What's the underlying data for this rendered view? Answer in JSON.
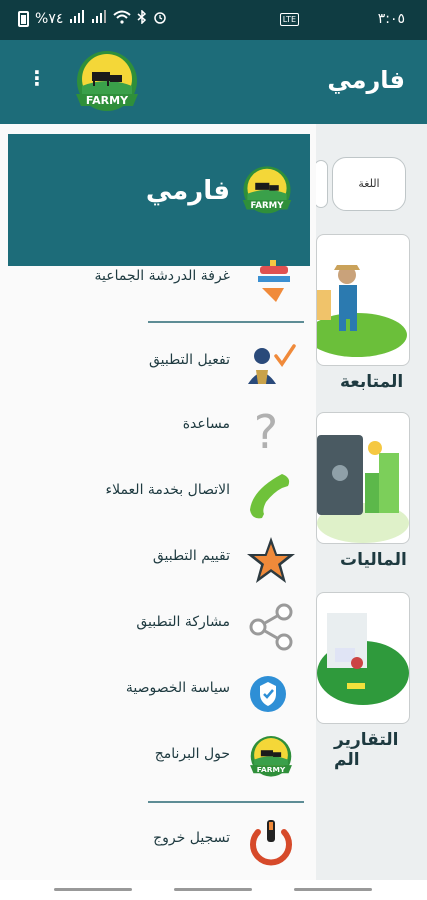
{
  "status_bar": {
    "time": "٣:٠٥",
    "battery": "%٧٤",
    "network": "LTE"
  },
  "app_bar": {
    "title": "فارمي",
    "logo_text": "FARMY"
  },
  "main": {
    "language_button": "اللغة",
    "cards": [
      {
        "label": "المتابعة"
      },
      {
        "label": "الماليات"
      },
      {
        "label": "التقارير الم"
      }
    ]
  },
  "drawer": {
    "title": "فارمي",
    "logo_text": "FARMY",
    "items": [
      {
        "label": "غرفة الدردشة الجماعية",
        "icon": "group-chat-icon"
      },
      {
        "label": "تفعيل التطبيق",
        "icon": "user-check-icon"
      },
      {
        "label": "مساعدة",
        "icon": "question-icon"
      },
      {
        "label": "الاتصال بخدمة العملاء",
        "icon": "phone-icon"
      },
      {
        "label": "تقييم التطبيق",
        "icon": "star-icon"
      },
      {
        "label": "مشاركة التطبيق",
        "icon": "share-icon"
      },
      {
        "label": "سياسة الخصوصية",
        "icon": "shield-icon"
      },
      {
        "label": "حول البرنامج",
        "icon": "farmy-logo-icon"
      },
      {
        "label": "تسجيل خروج",
        "icon": "power-icon"
      }
    ]
  },
  "colors": {
    "primary": "#1d6c79",
    "status_bar": "#0f3c42",
    "drawer_bg": "#fafafa",
    "text": "#1e3a40"
  }
}
